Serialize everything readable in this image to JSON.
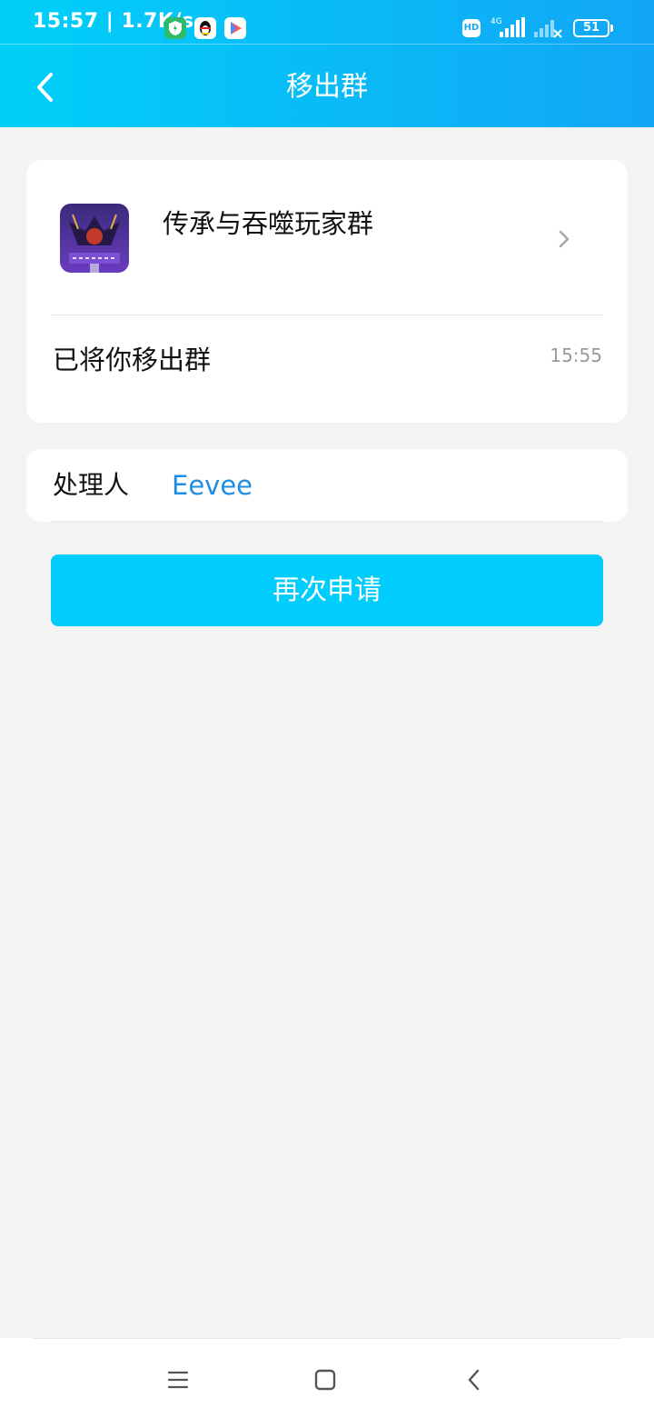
{
  "status_bar": {
    "time": "15:57 | 1.7K/s",
    "hd_label": "HD",
    "network_label": "4G",
    "battery": "51"
  },
  "nav": {
    "title": "移出群",
    "back_icon": "chevron-left-icon"
  },
  "group_card": {
    "group_name": "传承与吞噬玩家群",
    "notice": "已将你移出群",
    "time": "15:55",
    "avatar_colors": [
      "#2b1f5c",
      "#6a2fb0",
      "#c43a2a"
    ]
  },
  "handler": {
    "label": "处理人",
    "name": "Eevee"
  },
  "actions": {
    "reapply_label": "再次申请"
  },
  "system_nav": {
    "menu_icon": "menu-icon",
    "home_icon": "home-square-icon",
    "back_icon": "back-triangle-icon"
  },
  "colors": {
    "header_start": "#00d0f8",
    "header_end": "#12a6f5",
    "button": "#00cdfb",
    "link": "#1d8fe3",
    "background": "#f3f3f3"
  }
}
